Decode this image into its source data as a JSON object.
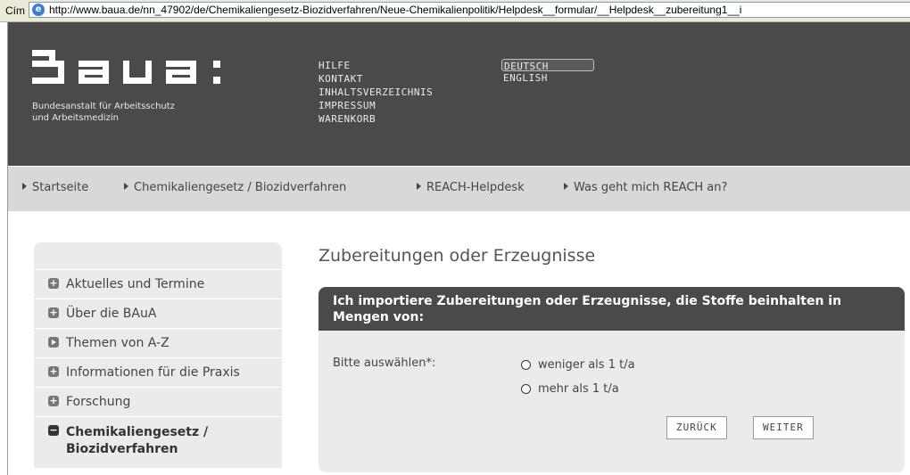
{
  "address_bar": {
    "label": "Cím",
    "url": "http://www.baua.de/nn_47902/de/Chemikaliengesetz-Biozidverfahren/Neue-Chemikalienpolitik/Helpdesk__formular/__Helpdesk__zubereitung1__i"
  },
  "header": {
    "logo_text": "baua:",
    "logo_subtitle_line1": "Bundesanstalt für Arbeitsschutz",
    "logo_subtitle_line2": "und Arbeitsmedizin",
    "nav": [
      "HILFE",
      "KONTAKT",
      "INHALTSVERZEICHNIS",
      "IMPRESSUM",
      "WARENKORB"
    ],
    "languages": {
      "active": "DEUTSCH",
      "other": "ENGLISH"
    }
  },
  "breadcrumb": [
    "Startseite",
    "Chemikaliengesetz / Biozidverfahren",
    "REACH-Helpdesk",
    "Was geht mich REACH an?"
  ],
  "sidebar": {
    "items": [
      {
        "label": "Aktuelles und Termine",
        "icon": "plus-icon"
      },
      {
        "label": "Über die BAuA",
        "icon": "plus-icon"
      },
      {
        "label": "Themen von A-Z",
        "icon": "play-icon"
      },
      {
        "label": "Informationen für die Praxis",
        "icon": "plus-icon"
      },
      {
        "label": "Forschung",
        "icon": "plus-icon"
      },
      {
        "label": "Chemikaliengesetz / Biozidverfahren",
        "icon": "minus-icon",
        "active": true
      }
    ]
  },
  "main": {
    "title": "Zubereitungen oder Erzeugnisse",
    "form": {
      "heading": "Ich importiere Zubereitungen oder Erzeugnisse, die Stoffe beinhalten in Mengen von:",
      "label": "Bitte auswählen*:",
      "options": [
        "weniger als 1 t/a",
        "mehr als 1 t/a"
      ],
      "back_label": "ZURÜCK",
      "next_label": "WEITER"
    }
  },
  "colors": {
    "header_bg": "#4a4a4a",
    "breadcrumb_bg": "#d8d8d8",
    "panel_bg": "#ebebeb"
  }
}
